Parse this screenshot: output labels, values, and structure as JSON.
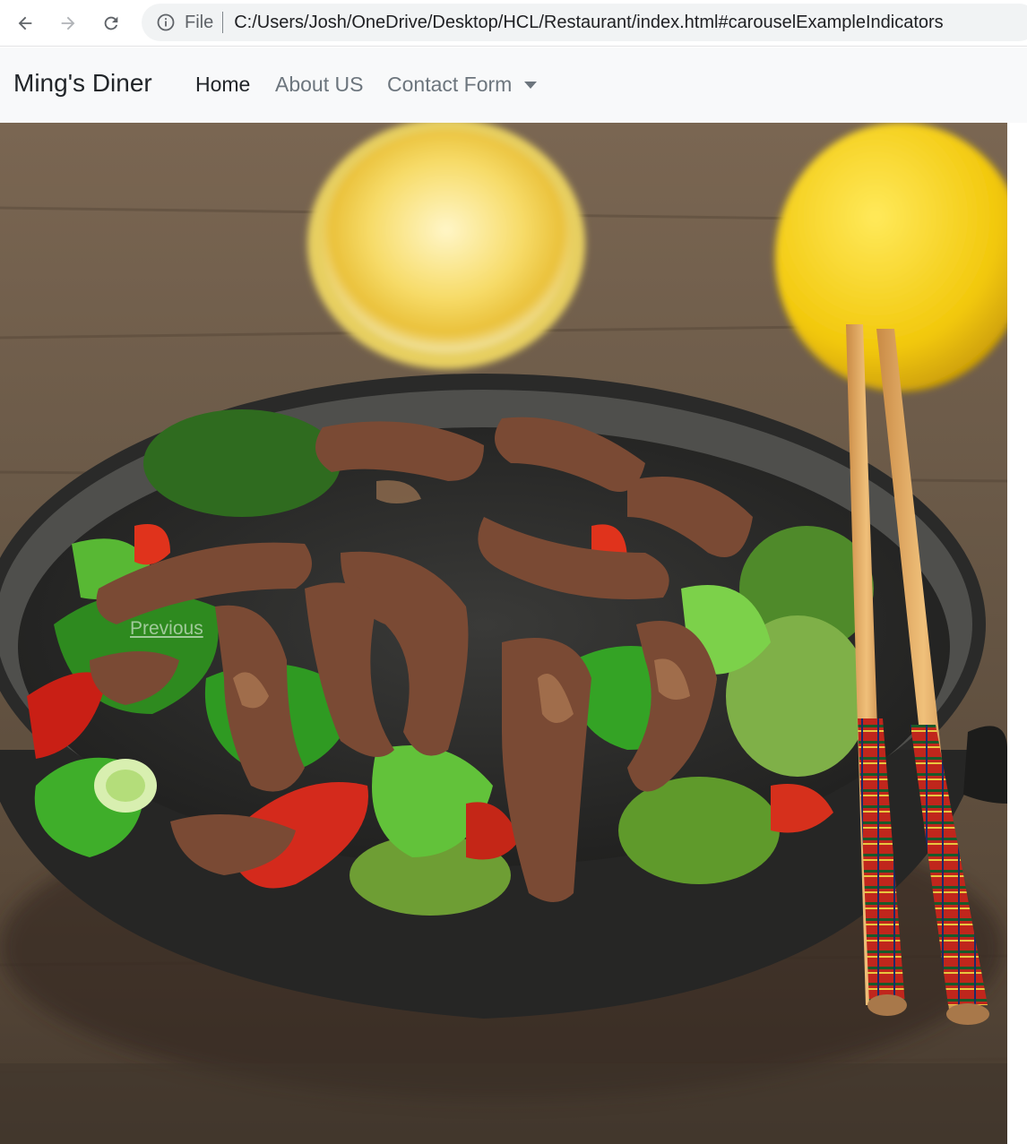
{
  "browser": {
    "scheme_label": "File",
    "url": "C:/Users/Josh/OneDrive/Desktop/HCL/Restaurant/index.html#carouselExampleIndicators",
    "icons": [
      "arrow-left-icon",
      "arrow-right-icon",
      "reload-icon",
      "info-icon"
    ]
  },
  "navbar": {
    "brand": "Ming's Diner",
    "links": [
      {
        "label": "Home",
        "active": true
      },
      {
        "label": "About US",
        "active": false
      },
      {
        "label": "Contact Form",
        "active": false,
        "dropdown": true
      }
    ]
  },
  "carousel": {
    "prev_label": "Previous",
    "image_subject": "beef and vegetable stir-fry in a wok with lemons and chopsticks"
  },
  "colors": {
    "navbar_bg": "#f8f9fa",
    "brand_text": "#212529",
    "muted_link": "#6c757d",
    "omnibox_bg": "#f1f3f4"
  }
}
